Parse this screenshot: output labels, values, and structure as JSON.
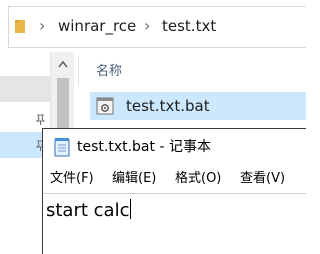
{
  "explorer": {
    "breadcrumb": {
      "separator": "›",
      "items": [
        "winrar_rce",
        "test.txt"
      ]
    },
    "columns": {
      "name_header": "名称"
    },
    "files": [
      {
        "name": "test.txt.bat",
        "selected": true
      }
    ]
  },
  "notepad": {
    "title": "test.txt.bat - 记事本",
    "menu": [
      "文件(F)",
      "编辑(E)",
      "格式(O)",
      "查看(V)"
    ],
    "content": "start calc"
  },
  "colors": {
    "selection": "#cce8ff",
    "hover": "#e5e5e5",
    "scroll_track": "#f0f0f0",
    "scroll_thumb": "#c1c1c1",
    "folder": "#e9b844"
  }
}
